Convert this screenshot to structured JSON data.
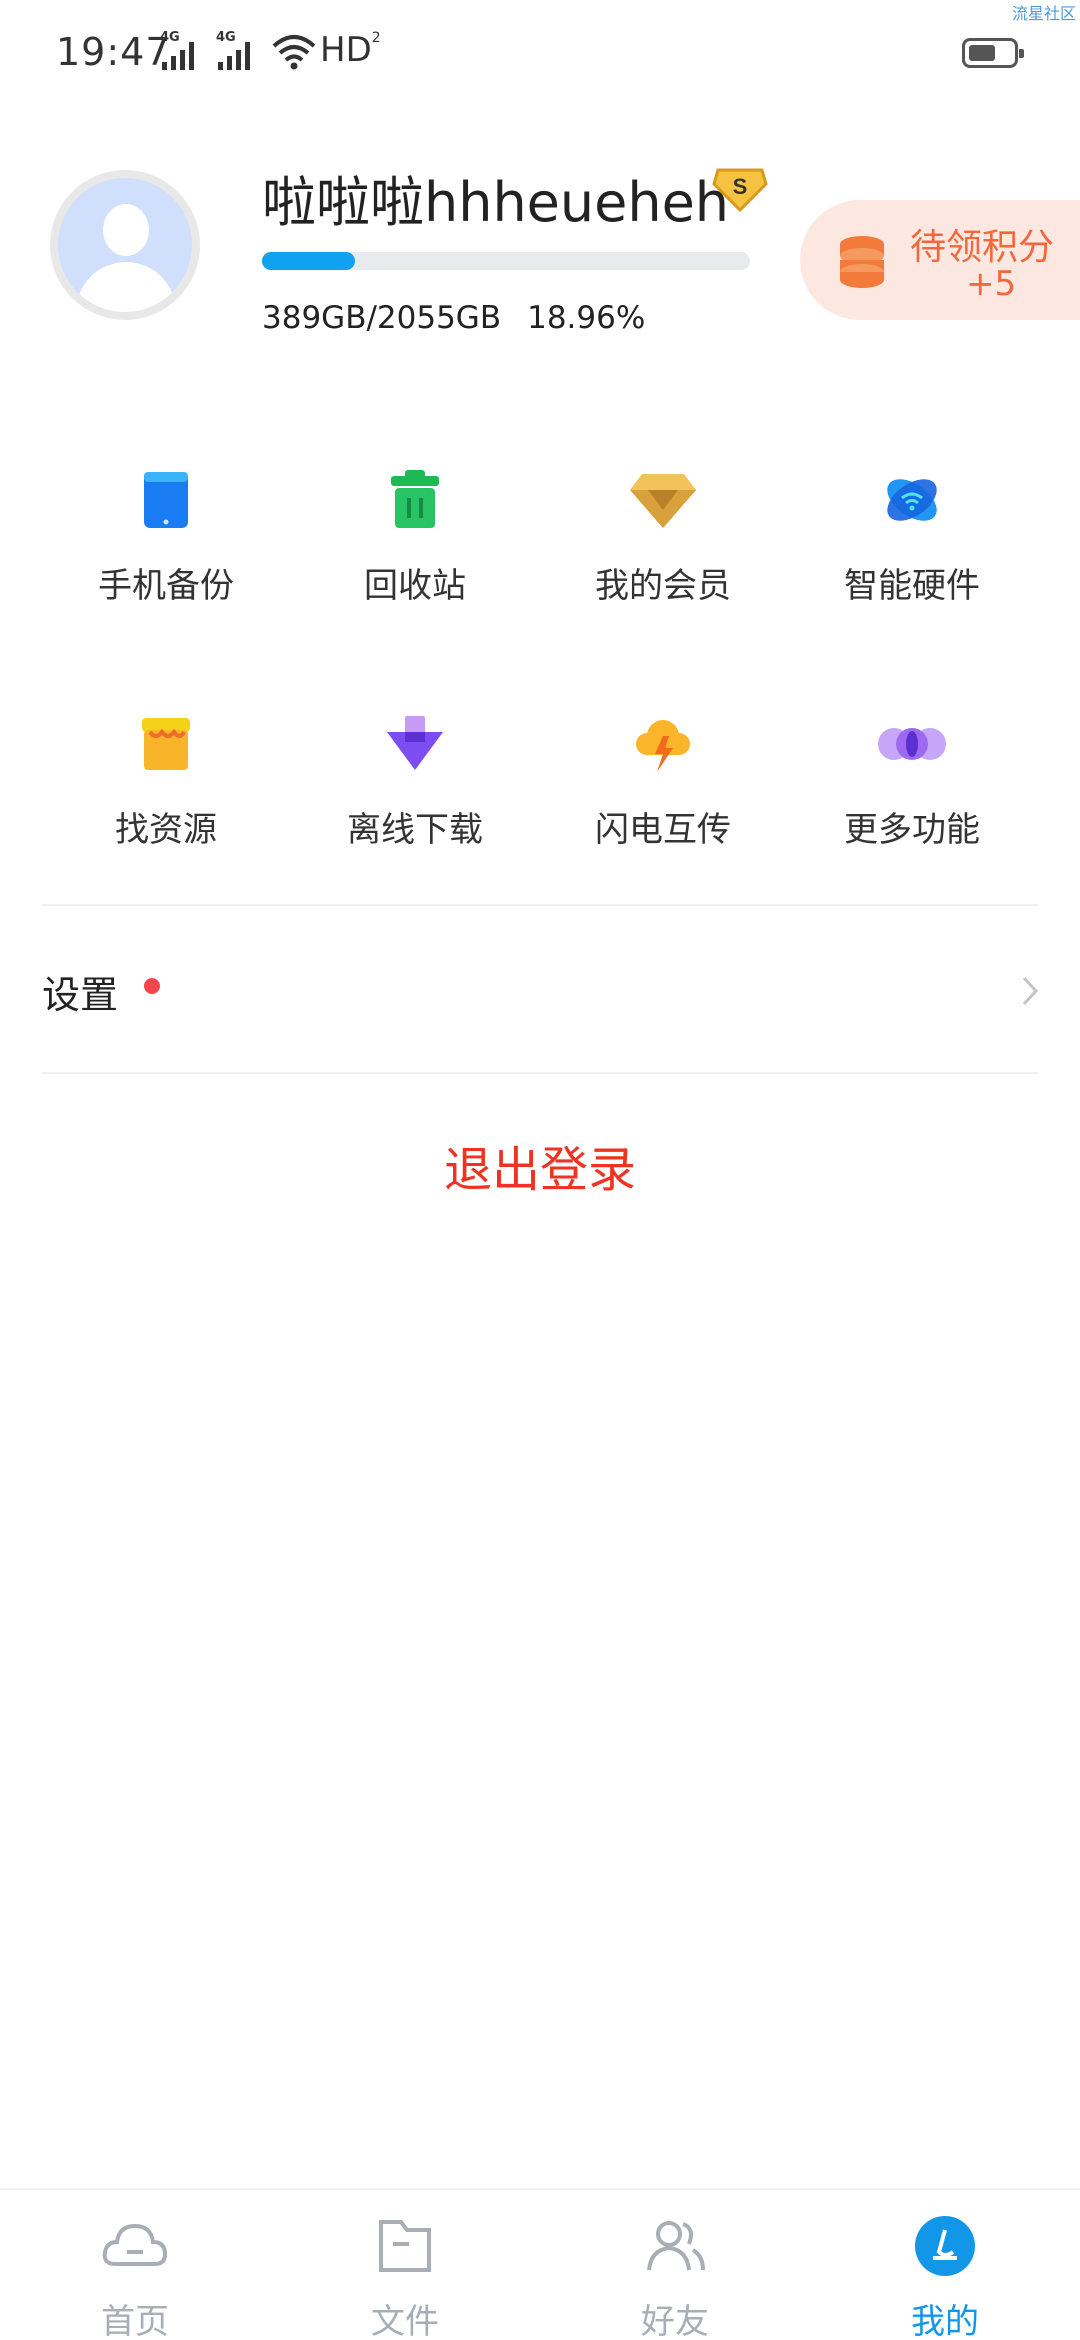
{
  "status_bar": {
    "time": "19:47",
    "network1": "4G",
    "network2": "4G",
    "hd_label": "HD",
    "hd_sub": "2",
    "watermark": "流星社区"
  },
  "profile": {
    "username": "啦啦啦hhheueheh",
    "vip_badge": "S",
    "storage_used_fraction": 0.1896,
    "storage_text": "389GB/2055GB",
    "storage_percent": "18.96%"
  },
  "points": {
    "label": "待领积分",
    "value": "+5"
  },
  "features": [
    {
      "label": "手机备份",
      "icon": "phone-icon"
    },
    {
      "label": "回收站",
      "icon": "trash-icon"
    },
    {
      "label": "我的会员",
      "icon": "diamond-icon"
    },
    {
      "label": "智能硬件",
      "icon": "smart-device-icon"
    },
    {
      "label": "找资源",
      "icon": "shop-icon"
    },
    {
      "label": "离线下载",
      "icon": "download-icon"
    },
    {
      "label": "闪电互传",
      "icon": "lightning-cloud-icon"
    },
    {
      "label": "更多功能",
      "icon": "more-icon"
    }
  ],
  "settings": {
    "label": "设置"
  },
  "logout_label": "退出登录",
  "tabbar": {
    "tabs": [
      {
        "label": "首页",
        "icon": "cloud-home-icon"
      },
      {
        "label": "文件",
        "icon": "folder-icon"
      },
      {
        "label": "好友",
        "icon": "friends-icon"
      },
      {
        "label": "我的",
        "icon": "profile-icon"
      }
    ],
    "active_index": 3
  },
  "colors": {
    "accent": "#1297e8",
    "logout": "#ee3322",
    "points": "#f2683c",
    "progress": "#12a0f0"
  }
}
